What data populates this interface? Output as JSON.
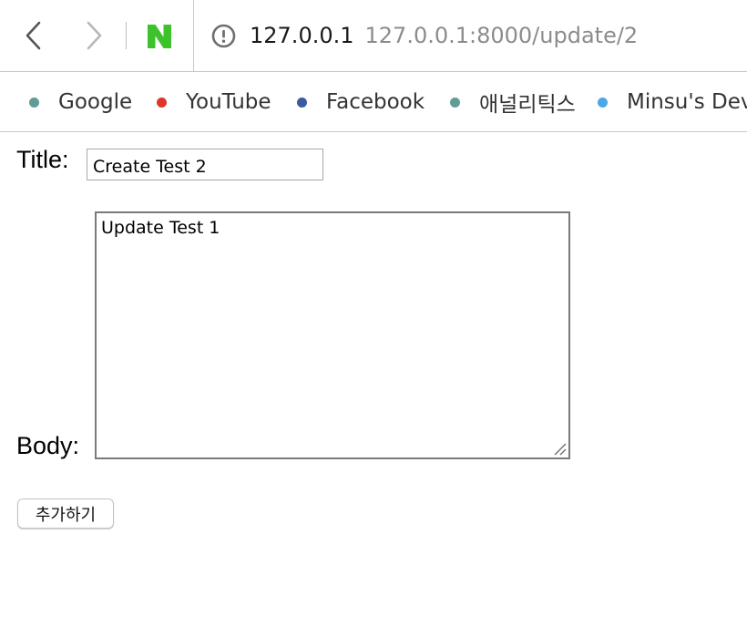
{
  "browser": {
    "back_icon": "chevron-left-icon",
    "forward_icon": "chevron-right-icon",
    "site_icon": "naver-logo",
    "site_letter": "N",
    "brand_color": "#3ec22c",
    "security_icon": "info-circle-icon",
    "address_host": "127.0.0.1",
    "address_full": "127.0.0.1:8000/update/2"
  },
  "bookmarks": [
    {
      "label": "Google",
      "color": "#5f9e97"
    },
    {
      "label": "YouTube",
      "color": "#e0352b"
    },
    {
      "label": "Facebook",
      "color": "#3b5aa0"
    },
    {
      "label": "애널리틱스",
      "color": "#5f9e97"
    },
    {
      "label": "Minsu's Dev",
      "color": "#4ea6e6"
    }
  ],
  "form": {
    "title_label": "Title:",
    "title_value": "Create Test 2",
    "body_label": "Body:",
    "body_value": "Update Test 1",
    "submit_label": "추가하기"
  }
}
